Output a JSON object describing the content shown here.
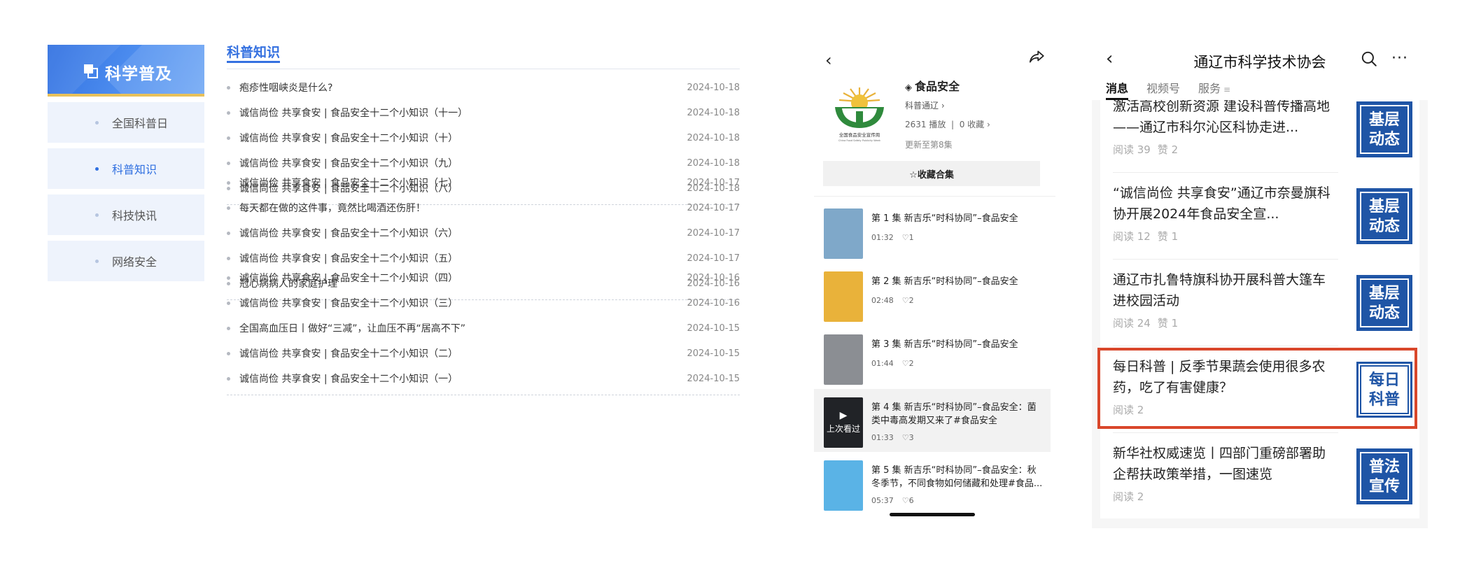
{
  "site": {
    "title": "科学普及",
    "nav": [
      {
        "label": "全国科普日",
        "active": false
      },
      {
        "label": "科普知识",
        "active": true
      },
      {
        "label": "科技快讯",
        "active": false
      },
      {
        "label": "网络安全",
        "active": false
      }
    ]
  },
  "articles": {
    "title": "科普知识",
    "groups": [
      [
        {
          "title": "疱疹性咽峡炎是什么?",
          "date": "2024-10-18"
        },
        {
          "title": "诚信尚俭 共享食安 | 食品安全十二个小知识（十一）",
          "date": "2024-10-18"
        },
        {
          "title": "诚信尚俭 共享食安 | 食品安全十二个小知识（十）",
          "date": "2024-10-18"
        },
        {
          "title": "诚信尚俭 共享食安 | 食品安全十二个小知识（九）",
          "date": "2024-10-18"
        },
        {
          "title": "诚信尚俭 共享食安 | 食品安全十二个小知识（八）",
          "date": "2024-10-18"
        }
      ],
      [
        {
          "title": "诚信尚俭 共享食安 | 食品安全十二个小知识（七）",
          "date": "2024-10-17"
        },
        {
          "title": "每天都在做的这件事，竟然比喝酒还伤肝！",
          "date": "2024-10-17"
        },
        {
          "title": "诚信尚俭 共享食安 | 食品安全十二个小知识（六）",
          "date": "2024-10-17"
        },
        {
          "title": "诚信尚俭 共享食安 | 食品安全十二个小知识（五）",
          "date": "2024-10-17"
        },
        {
          "title": "冠心病病人的家庭护理",
          "date": "2024-10-16"
        }
      ],
      [
        {
          "title": "诚信尚俭 共享食安 | 食品安全十二个小知识（四）",
          "date": "2024-10-16"
        },
        {
          "title": "诚信尚俭 共享食安 | 食品安全十二个小知识（三）",
          "date": "2024-10-16"
        },
        {
          "title": "全国高血压日丨做好“三减”，让血压不再“居高不下”",
          "date": "2024-10-15"
        },
        {
          "title": "诚信尚俭 共享食安 | 食品安全十二个小知识（二）",
          "date": "2024-10-15"
        },
        {
          "title": "诚信尚俭 共享食安 | 食品安全十二个小知识（一）",
          "date": "2024-10-15"
        }
      ]
    ]
  },
  "collection": {
    "name": "食品安全",
    "source": "科普通辽",
    "plays": "2631 播放",
    "stats_sep": "|",
    "favorites": "0  收藏",
    "updated": "更新至第8集",
    "collect_button": "☆收藏合集",
    "logo_text": "全国食品安全宣传周",
    "logo_subtext": "China Food Safety Publicity Week",
    "episodes": [
      {
        "title": "第 1 集   新吉乐“时科协同”–食品安全",
        "duration": "01:32",
        "likes": "1",
        "selected": false
      },
      {
        "title": "第 2 集   新吉乐“时科协同”–食品安全",
        "duration": "02:48",
        "likes": "2",
        "selected": false
      },
      {
        "title": "第 3 集   新吉乐“时科协同”–食品安全",
        "duration": "01:44",
        "likes": "2",
        "selected": false
      },
      {
        "title": "第 4 集   新吉乐“时科协同”–食品安全：菌类中毒高发期又来了#食品安全",
        "duration": "01:33",
        "likes": "3",
        "selected": true,
        "overlay": "上次看过"
      },
      {
        "title": "第 5 集   新吉乐“时科协同”–食品安全：秋冬季节，不同食物如何储藏和处理#食品...",
        "duration": "05:37",
        "likes": "6",
        "selected": false
      }
    ],
    "thumb_colors": [
      "#7fa8c9",
      "#e9b23a",
      "#8b8e93",
      "#3c4048",
      "#5ab3e6"
    ]
  },
  "account": {
    "title": "通辽市科学技术协会",
    "tabs": [
      {
        "label": "消息",
        "active": true
      },
      {
        "label": "视频号",
        "active": false
      },
      {
        "label": "服务",
        "active": false
      }
    ],
    "articles": [
      {
        "title": "激活高校创新资源 建设科普传播高地——通辽市科尔沁区科协走进...",
        "reads": "阅读 39",
        "likes": "赞 2",
        "thumb": "基层动态",
        "thumb_style": "blue"
      },
      {
        "title": "“诚信尚俭 共享食安”通辽市奈曼旗科协开展2024年食品安全宣...",
        "reads": "阅读 12",
        "likes": "赞 1",
        "thumb": "基层动态",
        "thumb_style": "blue"
      },
      {
        "title": "通辽市扎鲁特旗科协开展科普大篷车进校园活动",
        "reads": "阅读 24",
        "likes": "赞 1",
        "thumb": "基层动态",
        "thumb_style": "blue"
      },
      {
        "title": "每日科普 | 反季节果蔬会使用很多农药，吃了有害健康？",
        "reads": "阅读 2",
        "likes": "",
        "thumb": "每日科普",
        "thumb_style": "white",
        "highlighted": true
      },
      {
        "title": "新华社权威速览丨四部门重磅部署助企帮扶政策举措，一图速览",
        "reads": "阅读 2",
        "likes": "",
        "thumb": "普法宣传",
        "thumb_style": "blue"
      }
    ],
    "highlight_color": "#d9472b"
  }
}
